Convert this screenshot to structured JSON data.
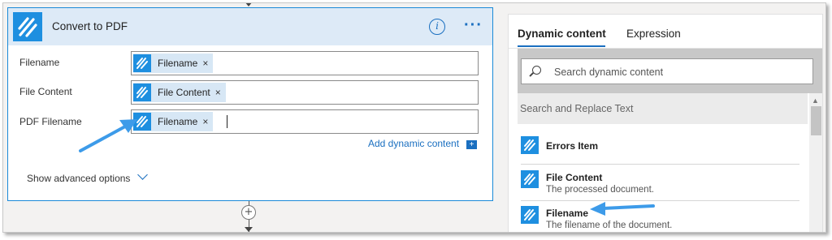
{
  "card": {
    "title": "Convert to PDF",
    "info_glyph": "i",
    "more_glyph": "···",
    "fields": [
      {
        "label": "Filename",
        "token": "Filename"
      },
      {
        "label": "File Content",
        "token": "File Content"
      },
      {
        "label": "PDF Filename",
        "token": "Filename"
      }
    ],
    "token_remove": "×",
    "add_dynamic_content": "Add dynamic content",
    "add_dynamic_glyph": "+",
    "show_advanced": "Show advanced options"
  },
  "connector": {
    "plus_glyph": "+"
  },
  "panel": {
    "tabs": [
      "Dynamic content",
      "Expression"
    ],
    "active_tab": "Dynamic content",
    "search_placeholder": "Search dynamic content",
    "section": "Search and Replace Text",
    "items": [
      {
        "title": "Errors Item",
        "description": ""
      },
      {
        "title": "File Content",
        "description": "The processed document."
      },
      {
        "title": "Filename",
        "description": "The filename of the document."
      }
    ]
  },
  "colors": {
    "accent": "#1a6fc0",
    "brand_icon": "#1e8fe0",
    "header_bg": "#ddeaf7",
    "token_bg": "#d7e7f5",
    "annotation_arrow": "#3d9be9"
  },
  "icons": {
    "app": "hatched-stripes-icon",
    "info": "info-circle-icon",
    "more": "ellipsis-icon",
    "search": "search-icon",
    "add": "plus-box-icon",
    "chevron": "chevron-down-icon"
  }
}
